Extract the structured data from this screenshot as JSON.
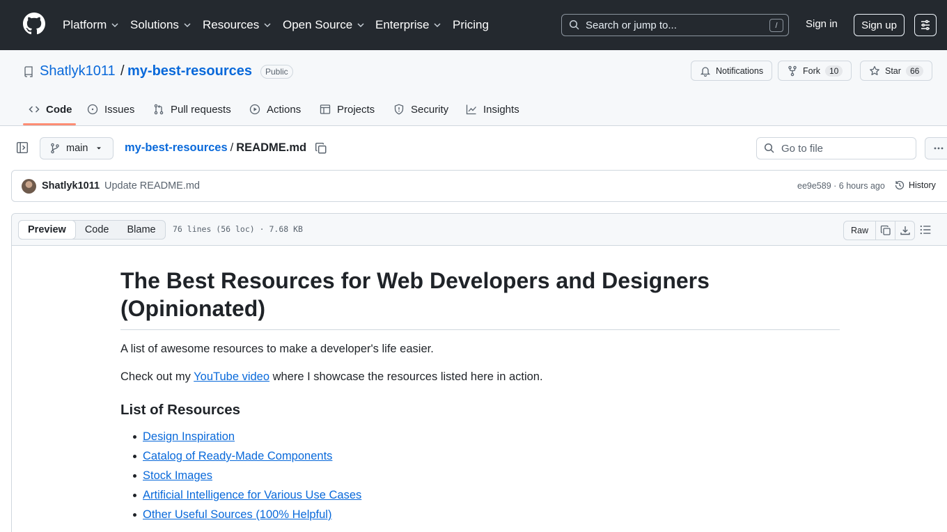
{
  "header": {
    "nav": [
      "Platform",
      "Solutions",
      "Resources",
      "Open Source",
      "Enterprise",
      "Pricing"
    ],
    "search_placeholder": "Search or jump to...",
    "search_shortcut": "/",
    "sign_in": "Sign in",
    "sign_up": "Sign up"
  },
  "repo": {
    "owner": "Shatlyk1011",
    "separator": "/",
    "name": "my-best-resources",
    "visibility": "Public",
    "notifications_label": "Notifications",
    "fork_label": "Fork",
    "fork_count": "10",
    "star_label": "Star",
    "star_count": "66",
    "tabs": [
      "Code",
      "Issues",
      "Pull requests",
      "Actions",
      "Projects",
      "Security",
      "Insights"
    ]
  },
  "file_nav": {
    "branch": "main",
    "breadcrumb_repo": "my-best-resources",
    "breadcrumb_sep": "/",
    "breadcrumb_file": "README.md",
    "goto_placeholder": "Go to file"
  },
  "commit": {
    "author": "Shatlyk1011",
    "message": "Update README.md",
    "meta": "ee9e589 · 6 hours ago",
    "history_label": "History"
  },
  "file": {
    "views": [
      "Preview",
      "Code",
      "Blame"
    ],
    "info": "76 lines (56 loc) · 7.68 KB",
    "raw_label": "Raw"
  },
  "readme": {
    "title": "The Best Resources for Web Developers and Designers (Opinionated)",
    "intro": "A list of awesome resources to make a developer's life easier.",
    "checkout_pre": "Check out my ",
    "checkout_link": "YouTube video",
    "checkout_post": " where I showcase the resources listed here in action.",
    "list_heading": "List of Resources",
    "list": [
      "Design Inspiration",
      "Catalog of Ready-Made Components",
      "Stock Images",
      "Artificial Intelligence for Various Use Cases",
      "Other Useful Sources (100% Helpful)"
    ]
  }
}
